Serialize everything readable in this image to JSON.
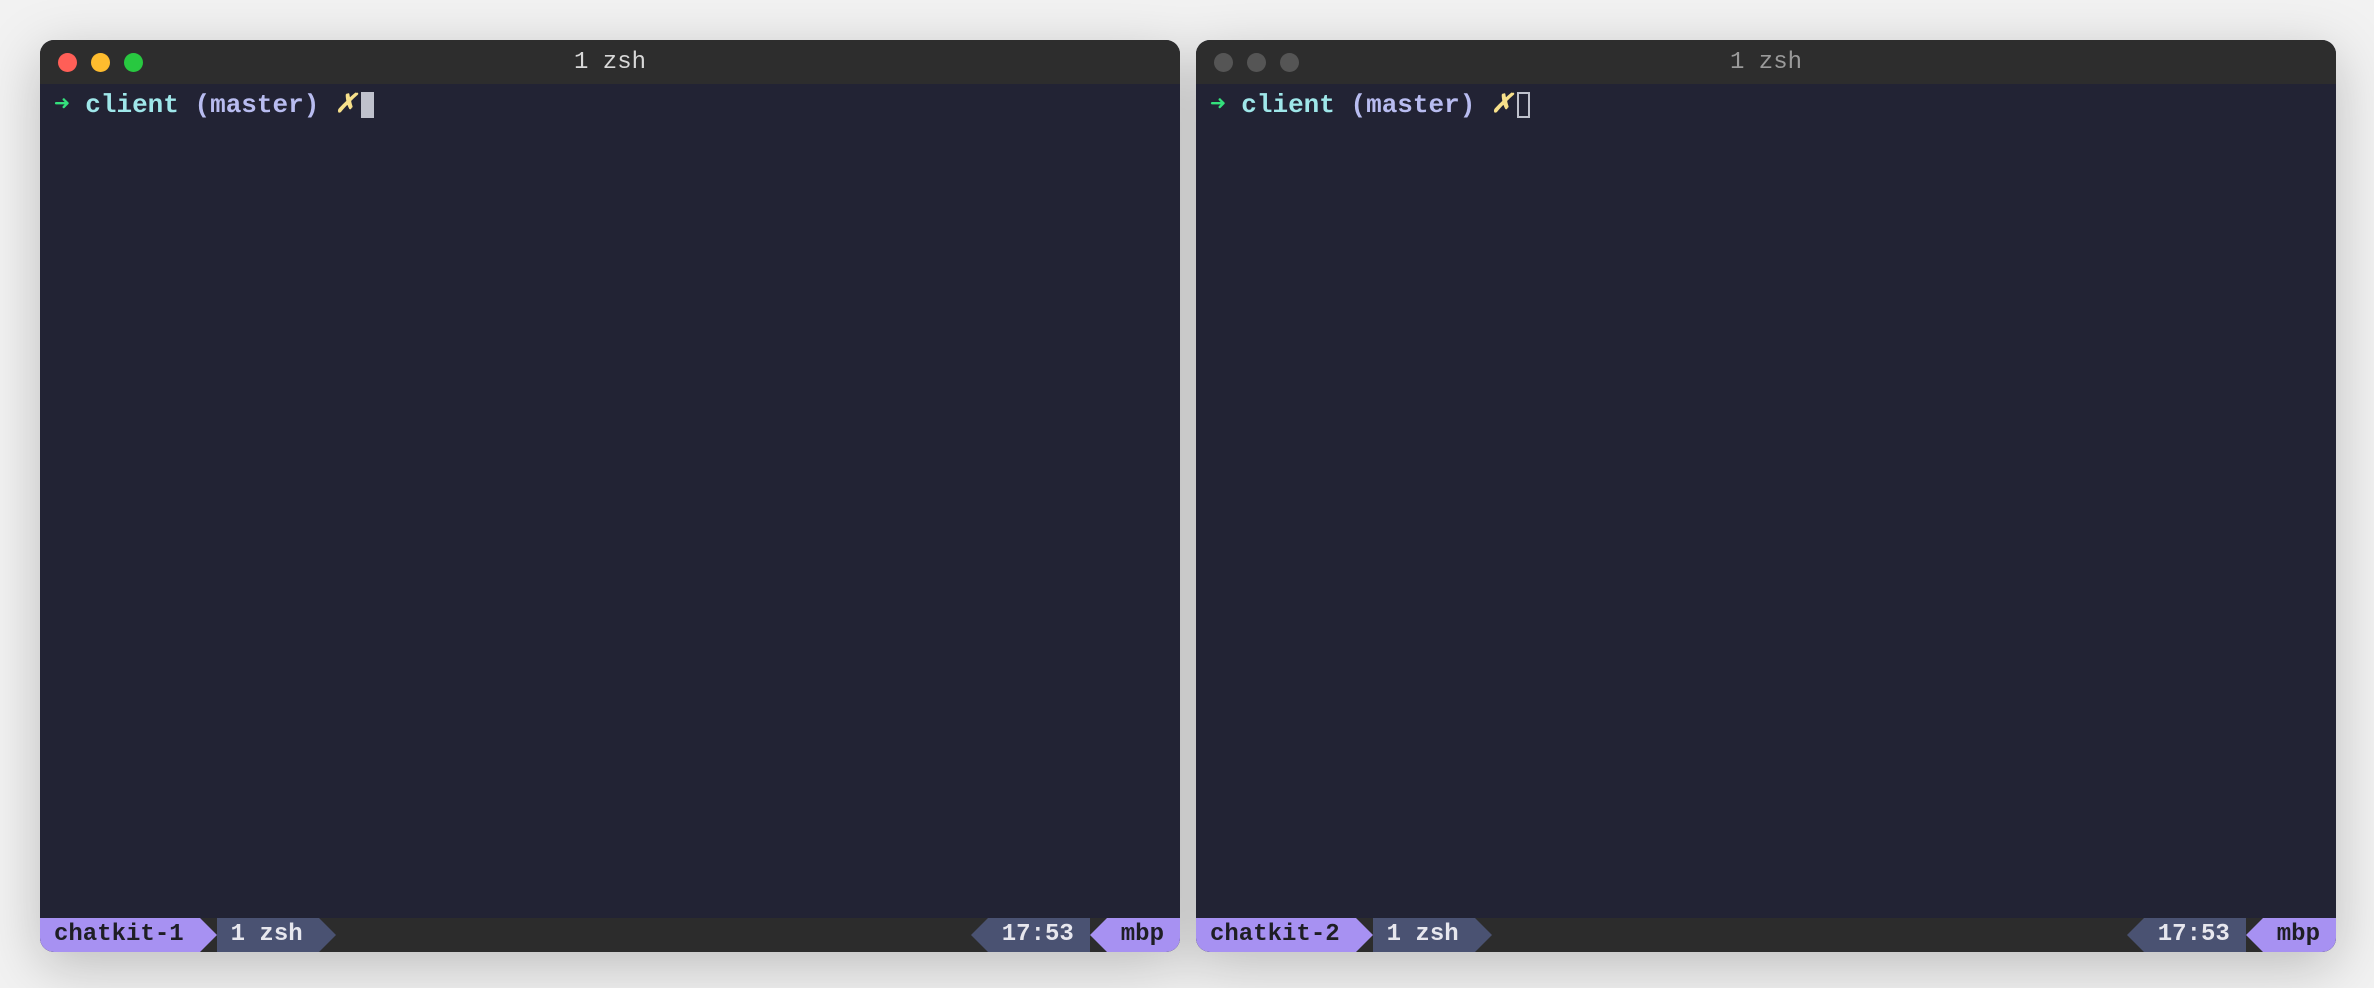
{
  "windows": [
    {
      "focused": true,
      "title": "1 zsh",
      "prompt": {
        "arrow": "➜",
        "cwd": "client",
        "branch": "(master)",
        "git_glyph": "✗"
      },
      "status": {
        "session": "chatkit-1",
        "window": "1 zsh",
        "time": "17:53",
        "host": "mbp"
      }
    },
    {
      "focused": false,
      "title": "1 zsh",
      "prompt": {
        "arrow": "➜",
        "cwd": "client",
        "branch": "(master)",
        "git_glyph": "✗"
      },
      "status": {
        "session": "chatkit-2",
        "window": "1 zsh",
        "time": "17:53",
        "host": "mbp"
      }
    }
  ]
}
